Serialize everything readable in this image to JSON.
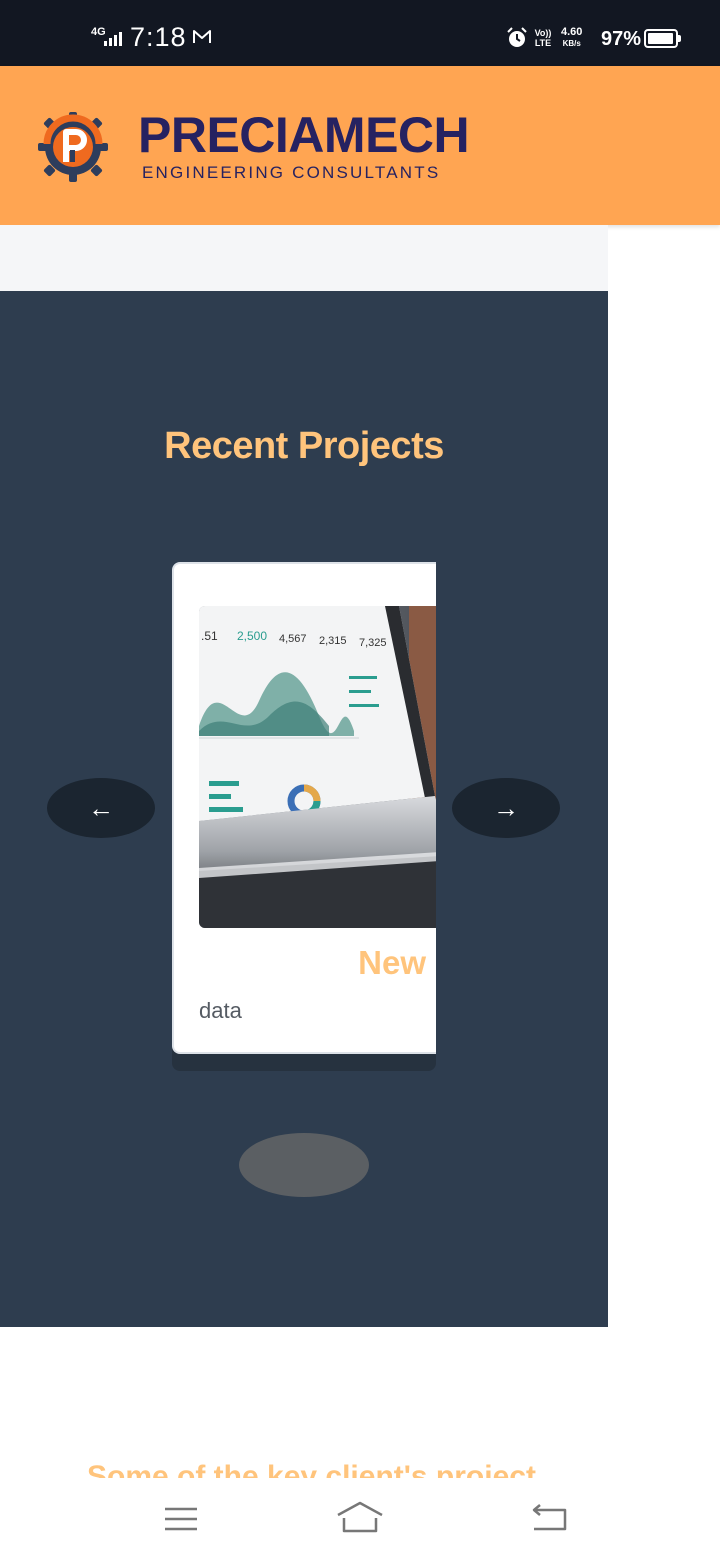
{
  "status_bar": {
    "network": "4G",
    "time": "7:18",
    "volte": "Vo)) LTE",
    "speed_value": "4.60",
    "speed_unit": "KB/s",
    "battery": "97%",
    "battery_level": 0.97
  },
  "header": {
    "brand_name": "PRECIAMECH",
    "tagline": "ENGINEERING CONSULTANTS"
  },
  "projects": {
    "title": "Recent Projects",
    "prev_label": "←",
    "next_label": "→",
    "card": {
      "title": "New",
      "description": "data",
      "image_icon": "analytics-dashboard-laptop-image"
    }
  },
  "clients": {
    "heading": "Some of the key client's project"
  },
  "colors": {
    "header_bg": "#ffa552",
    "brand_navy": "#262261",
    "section_bg": "#2e3d4f",
    "accent_gold": "#ffc47c"
  }
}
